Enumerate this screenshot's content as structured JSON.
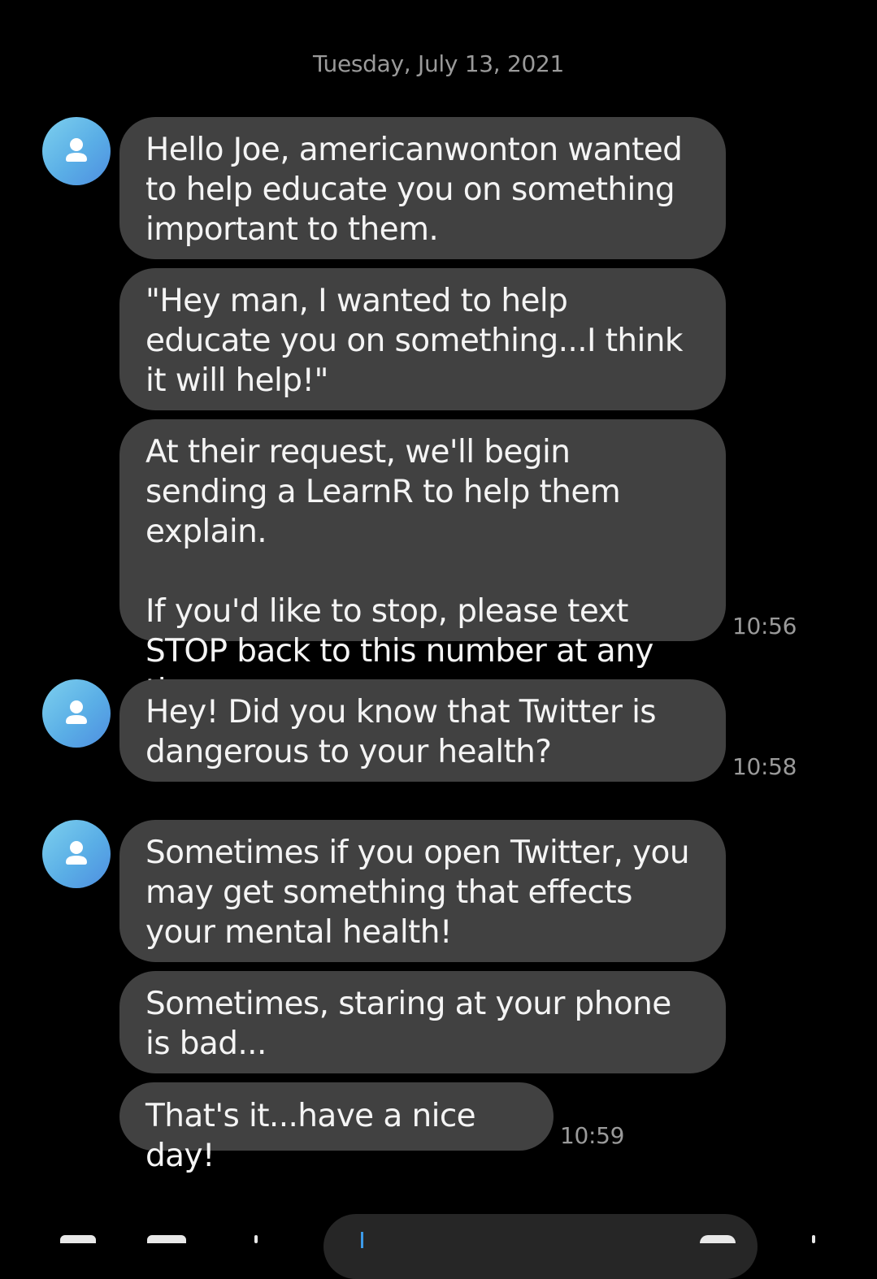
{
  "date_header": "Tuesday, July 13, 2021",
  "contact": {
    "avatar_icon": "person-icon",
    "avatar_colors": [
      "#7dd0ee",
      "#4e8ee0"
    ]
  },
  "messages": [
    {
      "text": "Hello Joe, americanwonton wanted to help educate you on something important to them."
    },
    {
      "text": "\"Hey man, I wanted to help educate you on something...I think it will help!\""
    },
    {
      "text": "At their request, we'll begin sending a LearnR to help them explain.\n\nIf you'd like to stop, please text STOP back to this number at any time.",
      "time": "10:56"
    },
    {
      "text": "Hey! Did you know that Twitter is dangerous to your health?",
      "time": "10:58"
    },
    {
      "text": "Sometimes if you open Twitter, you may get something that effects your mental health!"
    },
    {
      "text": "Sometimes, staring at your phone is bad..."
    },
    {
      "text": "That's it...have a nice day!",
      "time": "10:59"
    }
  ],
  "colors": {
    "background": "#000000",
    "bubble": "#414141",
    "muted_text": "#9a9a9a",
    "cursor": "#3d9be9"
  }
}
